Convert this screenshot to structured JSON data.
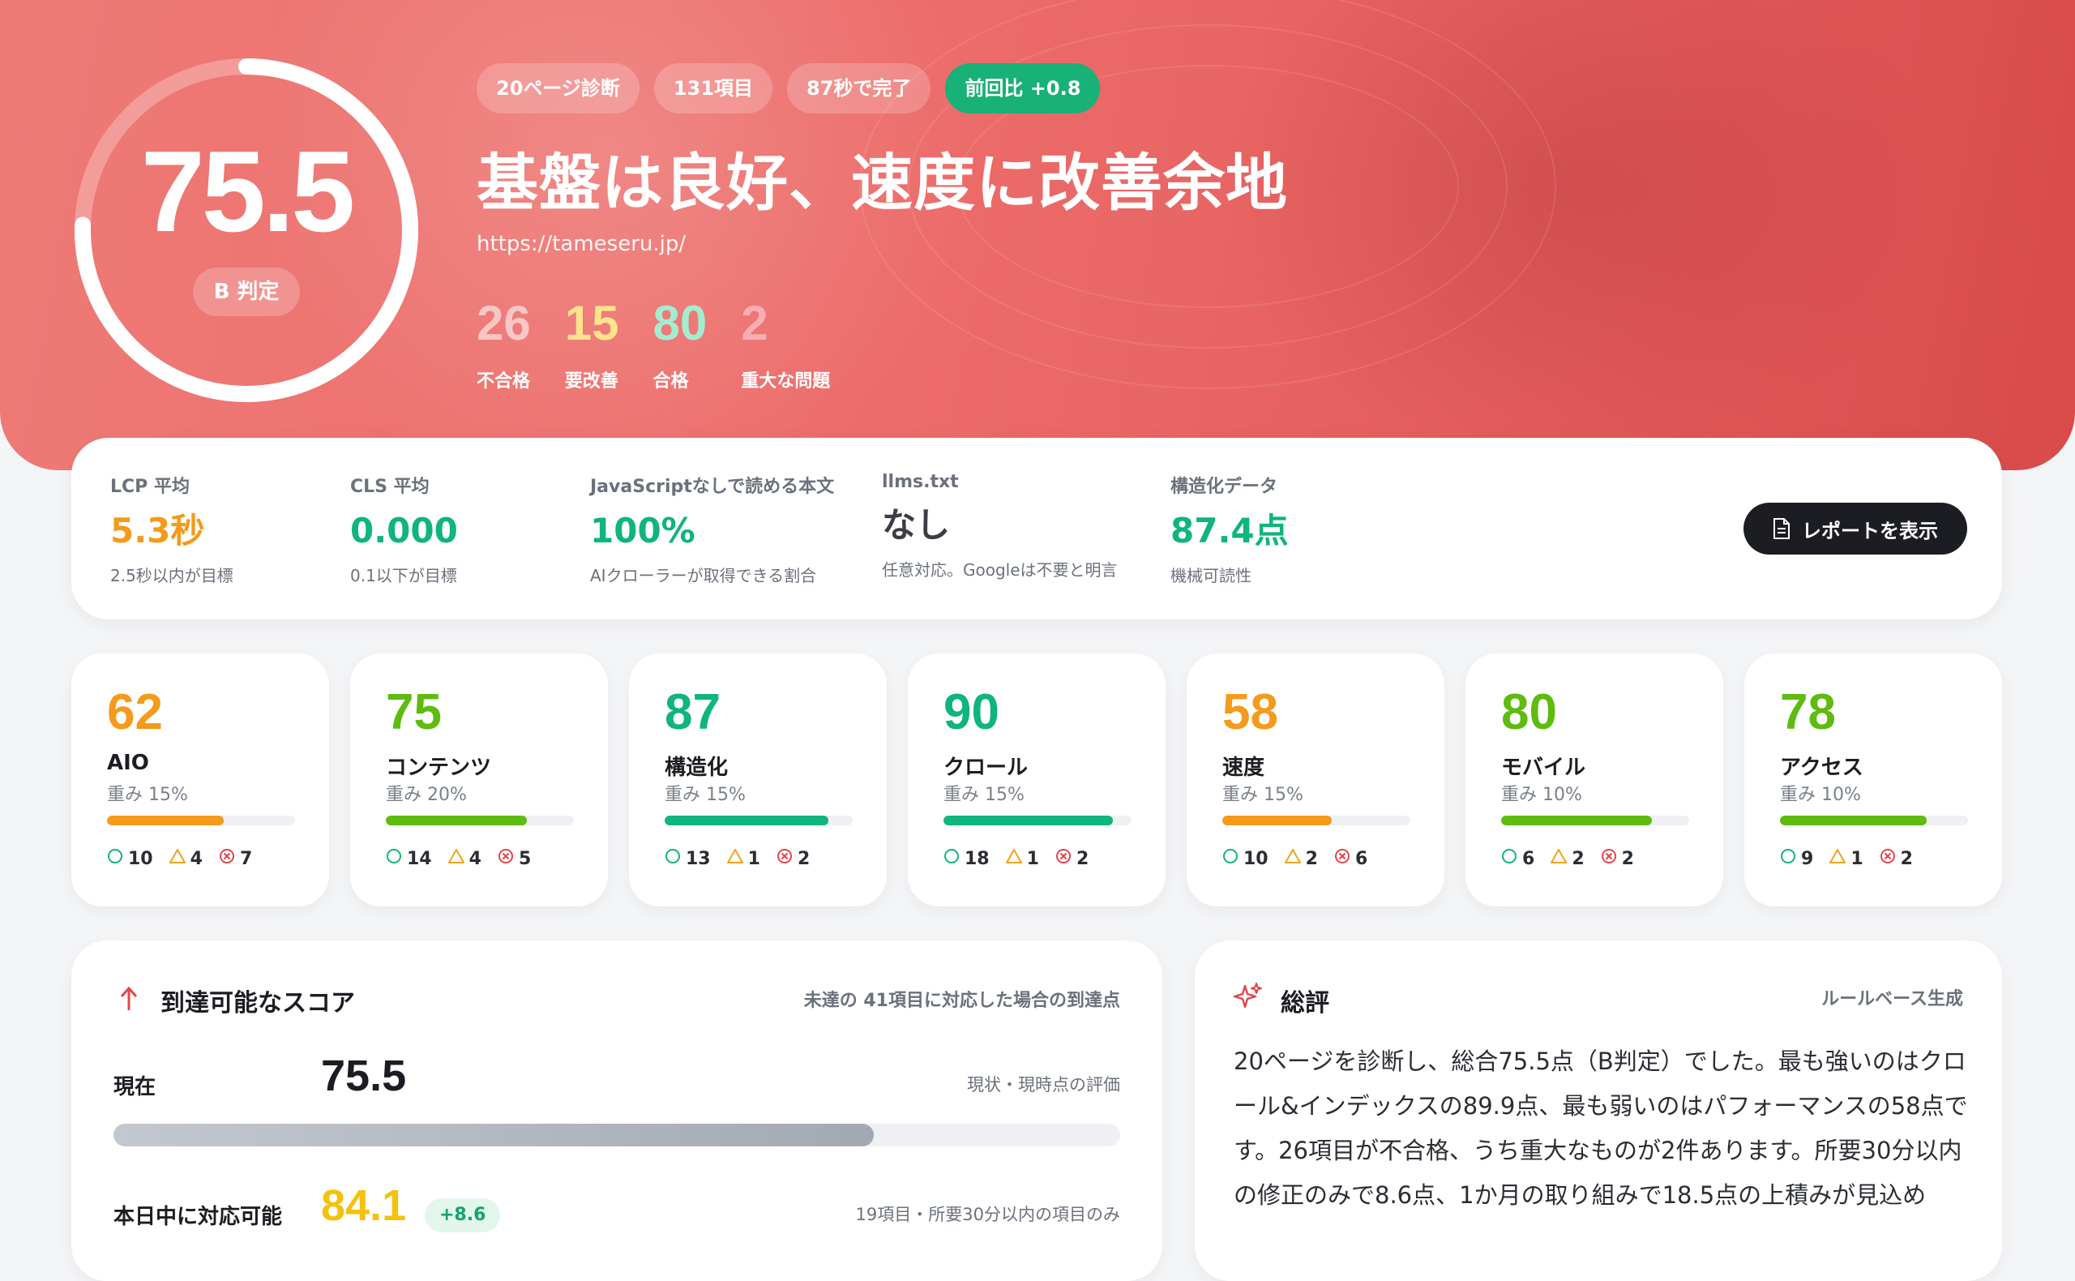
{
  "hero": {
    "score": "75.5",
    "score_fraction": 0.755,
    "grade": "B 判定",
    "chips": [
      "20ページ診断",
      "131項目",
      "87秒で完了"
    ],
    "delta_chip": "前回比 +0.8",
    "title": "基盤は良好、速度に改善余地",
    "url": "https://tameseru.jp/",
    "counts": [
      {
        "value": "26",
        "label": "不合格",
        "color": "#f6c7c4"
      },
      {
        "value": "15",
        "label": "要改善",
        "color": "#fde38d"
      },
      {
        "value": "80",
        "label": "合格",
        "color": "#a4ecd0"
      },
      {
        "value": "2",
        "label": "重大な問題",
        "color": "#f7aeb3"
      }
    ]
  },
  "metrics": [
    {
      "label": "LCP 平均",
      "value": "5.3秒",
      "sub": "2.5秒以内が目標",
      "color": "#f59a1b"
    },
    {
      "label": "CLS 平均",
      "value": "0.000",
      "sub": "0.1以下が目標",
      "color": "#0fb57a"
    },
    {
      "label": "JavaScriptなしで読める本文",
      "value": "100%",
      "sub": "AIクローラーが取得できる割合",
      "color": "#0fb57a"
    },
    {
      "label": "llms.txt",
      "value": "なし",
      "sub": "任意対応。Googleは不要と明言",
      "color": "#3a3d44"
    },
    {
      "label": "構造化データ",
      "value": "87.4点",
      "sub": "機械可読性",
      "color": "#0fb57a"
    }
  ],
  "report_button": "レポートを表示",
  "categories": [
    {
      "score": "62",
      "name": "AIO",
      "weight": "重み 15%",
      "level": 0.62,
      "color": "#f59a1b",
      "pass": "10",
      "warn": "4",
      "fail": "7"
    },
    {
      "score": "75",
      "name": "コンテンツ",
      "weight": "重み 20%",
      "level": 0.75,
      "color": "#5fbb0f",
      "pass": "14",
      "warn": "4",
      "fail": "5"
    },
    {
      "score": "87",
      "name": "構造化",
      "weight": "重み 15%",
      "level": 0.87,
      "color": "#0fb57a",
      "pass": "13",
      "warn": "1",
      "fail": "2"
    },
    {
      "score": "90",
      "name": "クロール",
      "weight": "重み 15%",
      "level": 0.9,
      "color": "#0fb57a",
      "pass": "18",
      "warn": "1",
      "fail": "2"
    },
    {
      "score": "58",
      "name": "速度",
      "weight": "重み 15%",
      "level": 0.58,
      "color": "#f59a1b",
      "pass": "10",
      "warn": "2",
      "fail": "6"
    },
    {
      "score": "80",
      "name": "モバイル",
      "weight": "重み 10%",
      "level": 0.8,
      "color": "#5fbb0f",
      "pass": "6",
      "warn": "2",
      "fail": "2"
    },
    {
      "score": "78",
      "name": "アクセス",
      "weight": "重み 10%",
      "level": 0.78,
      "color": "#5fbb0f",
      "pass": "9",
      "warn": "1",
      "fail": "2"
    }
  ],
  "reachable": {
    "title": "到達可能なスコア",
    "note": "未達の 41項目に対応した場合の到達点",
    "current_label": "現在",
    "current_value": "75.5",
    "current_note": "現状・現時点の評価",
    "current_level": 0.755,
    "today_label": "本日中に対応可能",
    "today_value": "84.1",
    "today_delta": "+8.6",
    "today_note": "19項目・所要30分以内の項目のみ"
  },
  "summary": {
    "title": "総評",
    "note": "ルールベース生成",
    "text": "20ページを診断し、総合75.5点（B判定）でした。最も強いのはクロール&インデックスの89.9点、最も弱いのはパフォーマンスの58点です。26項目が不合格、うち重大なものが2件あります。所要30分以内の修正のみで8.6点、1か月の取り組みで18.5点の上積みが見込め"
  }
}
